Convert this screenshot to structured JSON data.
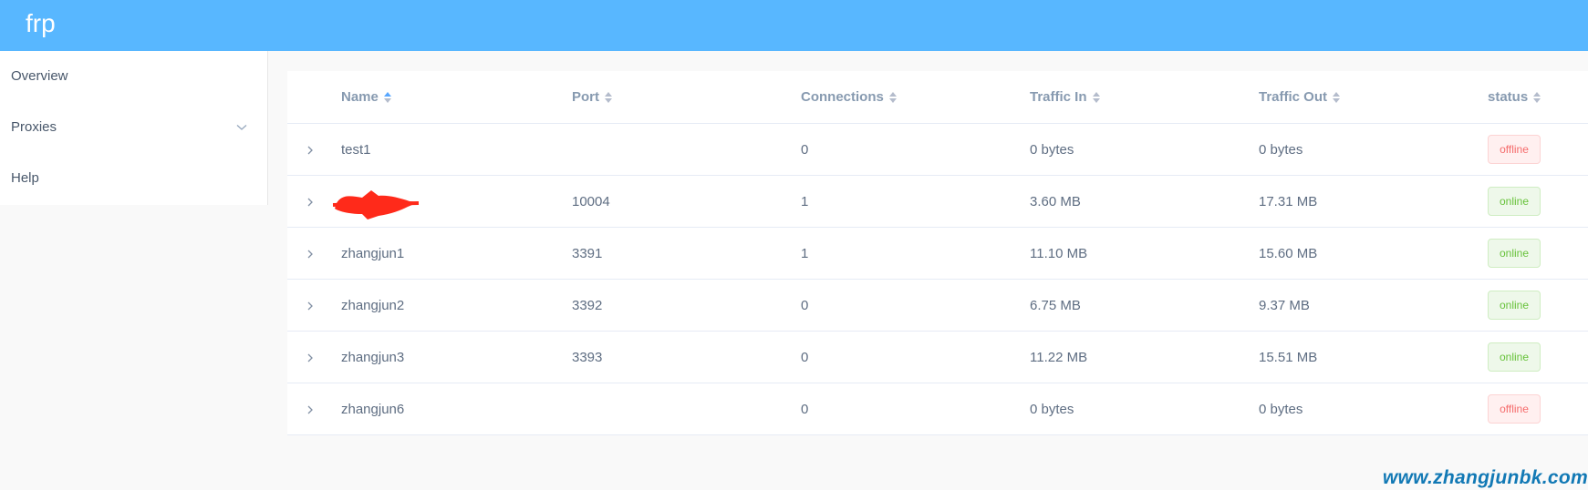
{
  "header": {
    "brand": "frp",
    "color": "#58b7ff"
  },
  "sidebar": {
    "items": [
      {
        "label": "Overview"
      },
      {
        "label": "Proxies",
        "icon": "chevron-down-icon"
      },
      {
        "label": "Help"
      }
    ]
  },
  "table": {
    "columns": [
      "Name",
      "Port",
      "Connections",
      "Traffic In",
      "Traffic Out",
      "status"
    ],
    "sorted_column": "Name",
    "rows": [
      {
        "name": "test1",
        "port": "",
        "connections": "0",
        "traffic_in": "0 bytes",
        "traffic_out": "0 bytes",
        "status": "offline"
      },
      {
        "name": "",
        "name_redacted": true,
        "port": "10004",
        "connections": "1",
        "traffic_in": "3.60 MB",
        "traffic_out": "17.31 MB",
        "status": "online"
      },
      {
        "name": "zhangjun1",
        "port": "3391",
        "connections": "1",
        "traffic_in": "11.10 MB",
        "traffic_out": "15.60 MB",
        "status": "online"
      },
      {
        "name": "zhangjun2",
        "port": "3392",
        "connections": "0",
        "traffic_in": "6.75 MB",
        "traffic_out": "9.37 MB",
        "status": "online"
      },
      {
        "name": "zhangjun3",
        "port": "3393",
        "connections": "0",
        "traffic_in": "11.22 MB",
        "traffic_out": "15.51 MB",
        "status": "online"
      },
      {
        "name": "zhangjun6",
        "port": "",
        "connections": "0",
        "traffic_in": "0 bytes",
        "traffic_out": "0 bytes",
        "status": "offline"
      }
    ]
  },
  "watermark": "www.zhangjunbk.com",
  "colors": {
    "online": "#67c23a",
    "offline": "#f56c6c",
    "redaction": "#ff2a1a"
  }
}
